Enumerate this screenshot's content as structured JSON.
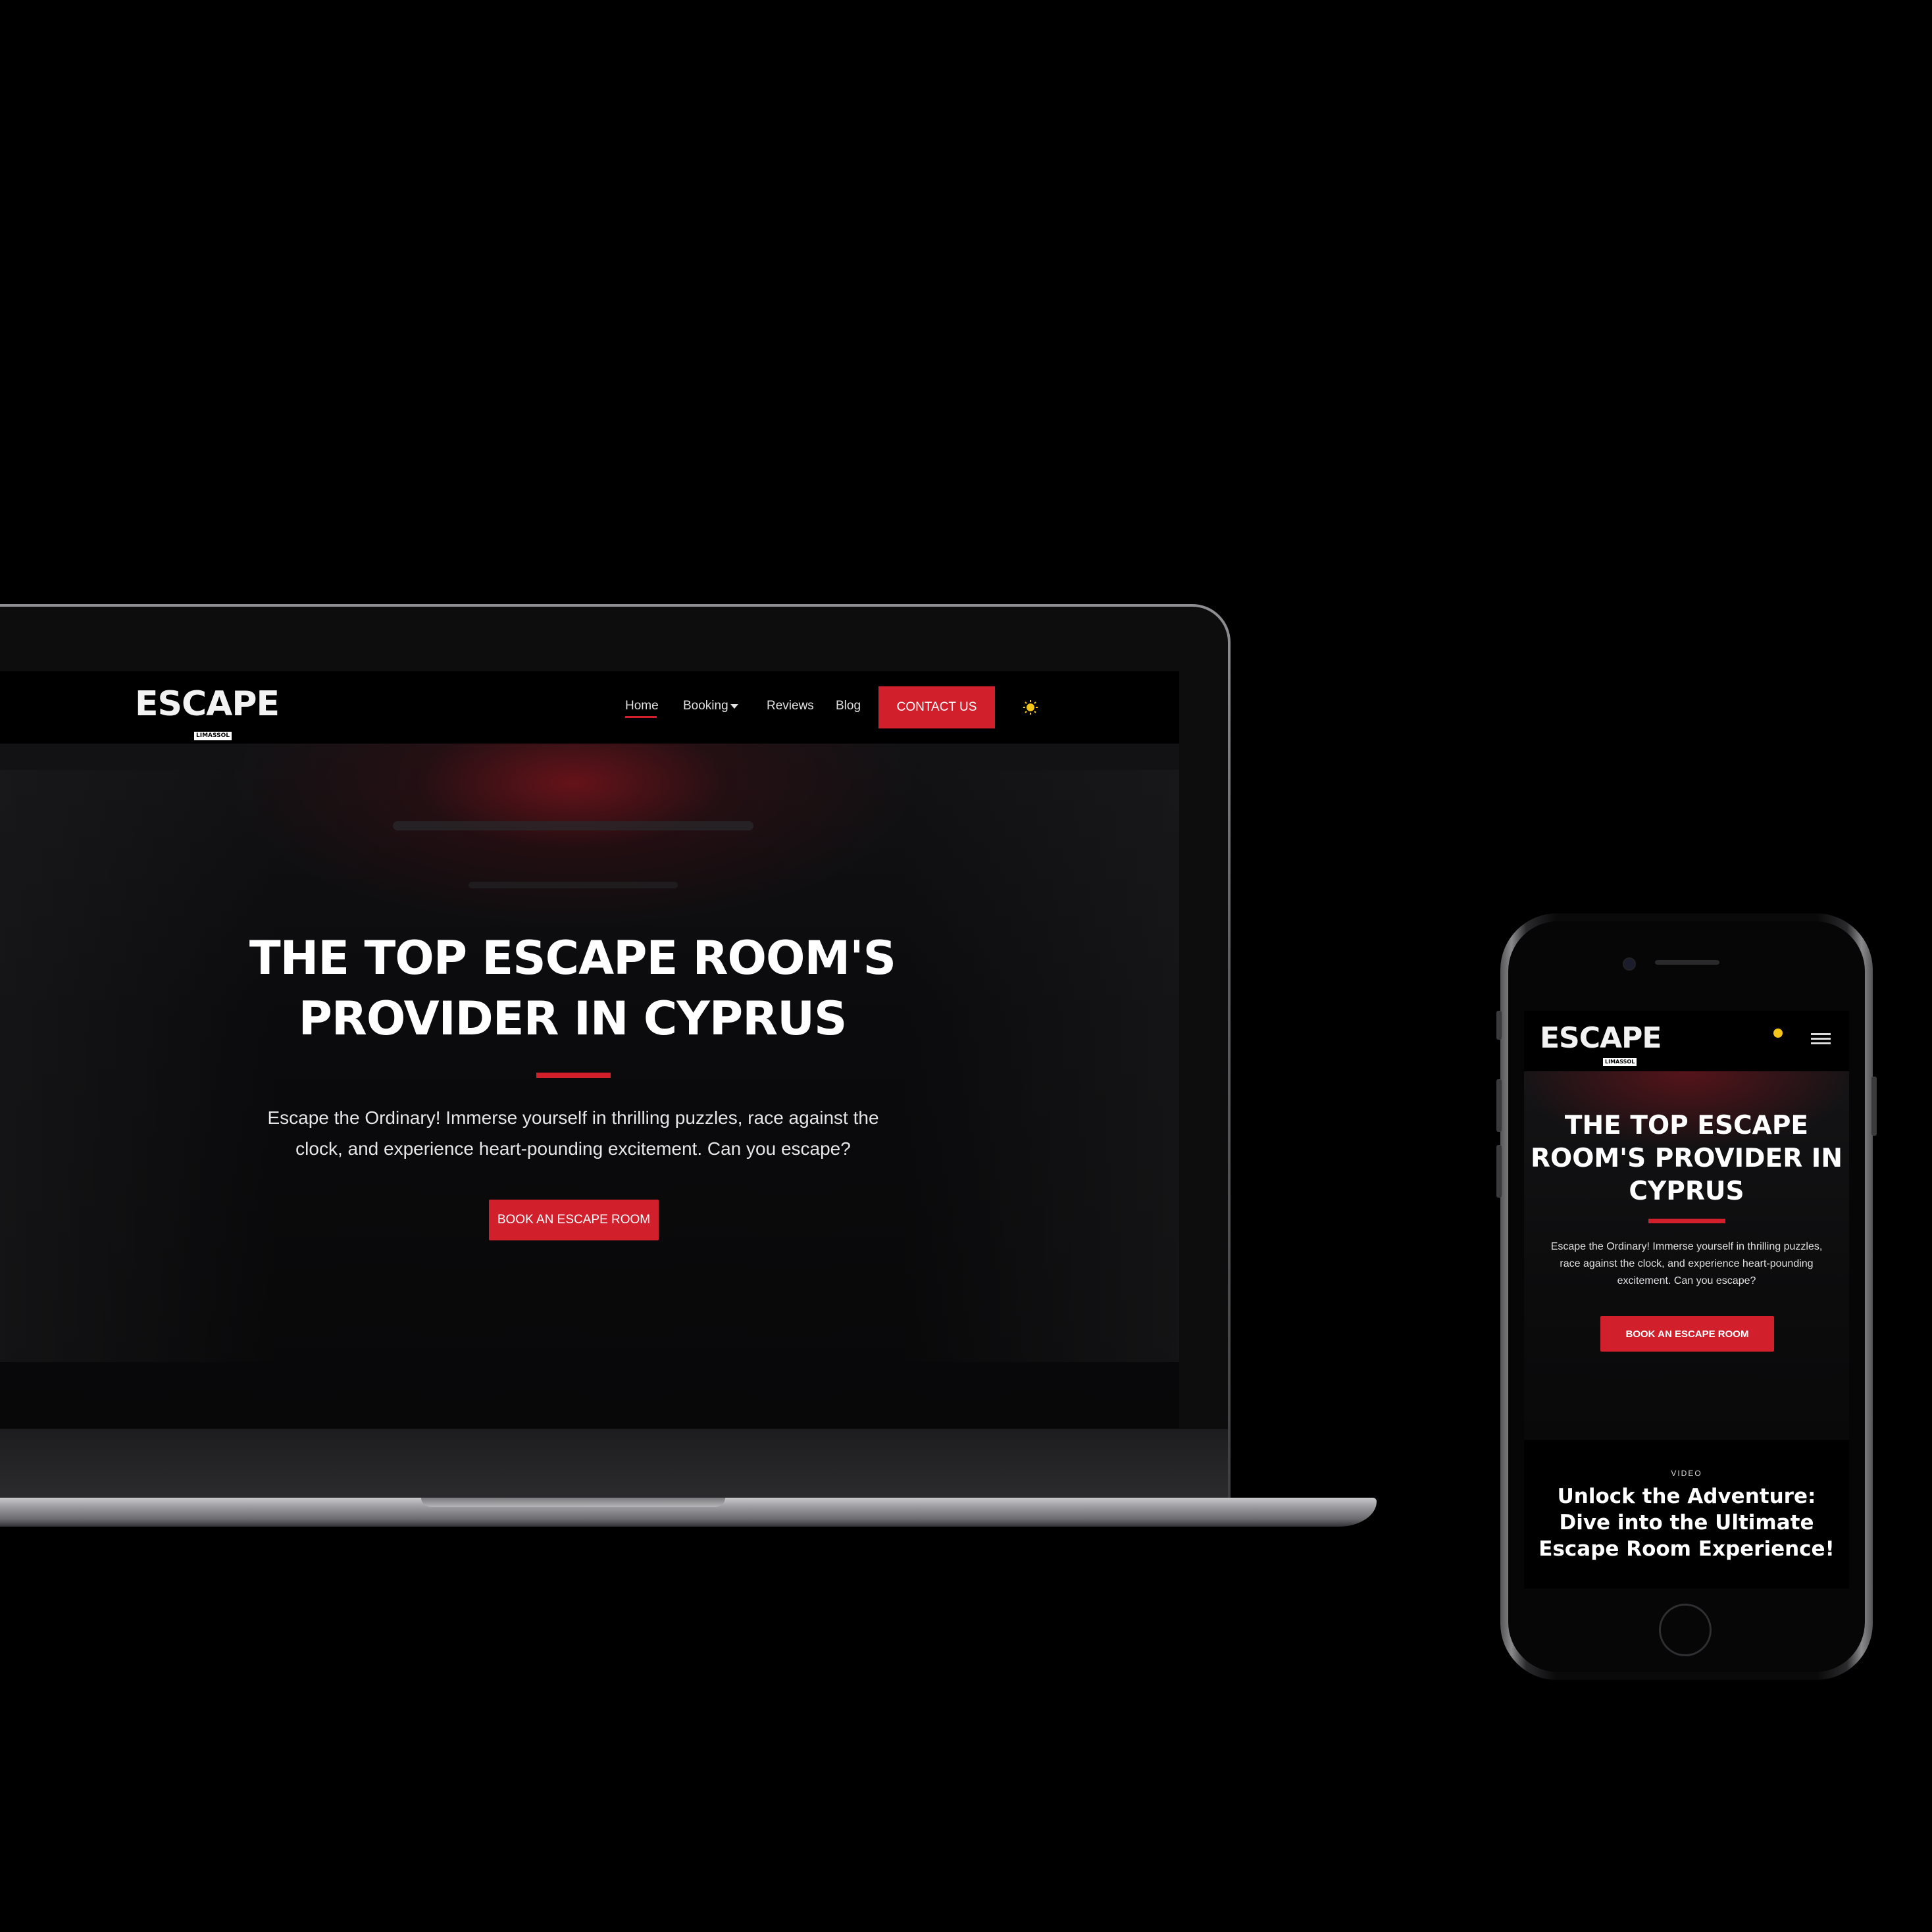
{
  "laptop": {
    "logo": {
      "word": "ESCAPE",
      "sub": "LIMASSOL"
    },
    "nav": {
      "items": [
        "Home",
        "Booking",
        "Reviews",
        "Blog"
      ],
      "active": "Home",
      "contact_button": "CONTACT US",
      "theme_icon": "sun-icon"
    },
    "hero": {
      "title_line1": "THE TOP ESCAPE ROOM'S",
      "title_line2": "PROVIDER IN CYPRUS",
      "description": "Escape the Ordinary! Immerse yourself in thrilling puzzles, race against the clock, and experience heart-pounding excitement. Can you escape?",
      "button": "BOOK AN ESCAPE ROOM"
    }
  },
  "phone": {
    "logo": {
      "word": "ESCAPE",
      "sub": "LIMASSOL"
    },
    "nav": {
      "theme_icon": "sun-icon",
      "menu_icon": "hamburger-menu-icon"
    },
    "hero": {
      "title": "THE TOP ESCAPE ROOM'S PROVIDER IN CYPRUS",
      "description": "Escape the Ordinary! Immerse yourself in thrilling puzzles, race against the clock, and experience heart-pounding excitement. Can you escape?",
      "button": "BOOK AN ESCAPE ROOM"
    },
    "video_section": {
      "label": "VIDEO",
      "title": "Unlock the Adventure: Dive into the Ultimate Escape Room Experience!"
    }
  },
  "colors": {
    "accent": "#d11f2b",
    "background": "#000000",
    "sun": "#f5c518"
  }
}
